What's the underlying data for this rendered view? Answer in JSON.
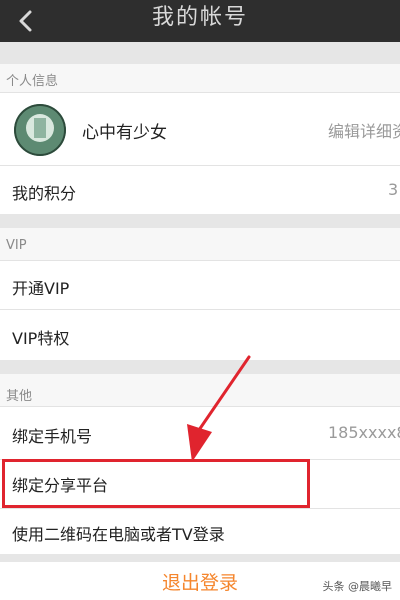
{
  "header": {
    "title": "我的帐号",
    "back_icon": "chevron-left-icon"
  },
  "sections": {
    "personal": {
      "title": "个人信息",
      "username": "心中有少女",
      "edit_label": "编辑详细资",
      "points_label": "我的积分",
      "points_value": "3"
    },
    "vip": {
      "title": "VIP",
      "open_vip": "开通VIP",
      "vip_privileges": "VIP特权"
    },
    "other": {
      "title": "其他",
      "bind_phone": "绑定手机号",
      "phone_value": "185xxxx8",
      "bind_share": "绑定分享平台",
      "qr_login": "使用二维码在电脑或者TV登录"
    }
  },
  "logout_label": "退出登录",
  "watermark": "头条 @晨曦早",
  "annotation": {
    "color": "#e0242e"
  }
}
